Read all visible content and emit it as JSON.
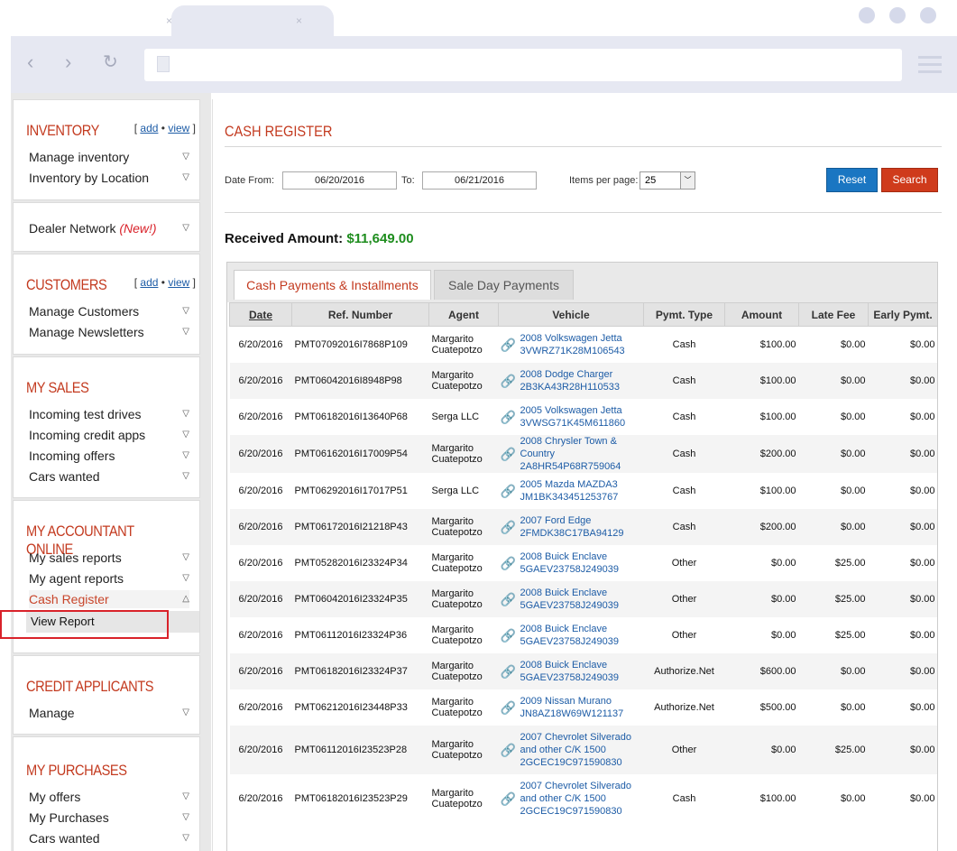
{
  "browser": {
    "tab_close": "×",
    "back": "‹",
    "forward": "›",
    "reload": "↻"
  },
  "sidebar": {
    "inventory": {
      "title": "INVENTORY",
      "add": "add",
      "view": "view",
      "items": [
        "Manage inventory",
        "Inventory by Location"
      ]
    },
    "dealer": {
      "label": "Dealer Network",
      "badge": "(New!)"
    },
    "customers": {
      "title": "CUSTOMERS",
      "add": "add",
      "view": "view",
      "items": [
        "Manage Customers",
        "Manage Newsletters"
      ]
    },
    "sales": {
      "title": "MY SALES",
      "items": [
        "Incoming test drives",
        "Incoming credit apps",
        "Incoming offers",
        "Cars wanted"
      ]
    },
    "accountant": {
      "title": "MY ACCOUNTANT ONLINE",
      "items": [
        "My sales reports",
        "My agent reports",
        "Cash Register"
      ],
      "sub": "View Report"
    },
    "credit": {
      "title": "CREDIT APPLICANTS",
      "items": [
        "Manage"
      ]
    },
    "purchases": {
      "title": "MY PURCHASES",
      "items": [
        "My offers",
        "My Purchases",
        "Cars wanted"
      ]
    }
  },
  "main": {
    "title": "CASH REGISTER",
    "date_from_label": "Date From:",
    "date_from": "06/20/2016",
    "to_label": "To:",
    "date_to": "06/21/2016",
    "items_label": "Items per page:",
    "items_value": "25",
    "reset": "Reset",
    "search": "Search",
    "received_label": "Received Amount:",
    "received_amount": "$11,649.00",
    "tabs": [
      "Cash Payments & Installments",
      "Sale Day Payments"
    ],
    "columns": [
      "Date",
      "Ref. Number",
      "Agent",
      "Vehicle",
      "Pymt. Type",
      "Amount",
      "Late Fee",
      "Early Pymt."
    ],
    "rows": [
      {
        "date": "6/20/2016",
        "ref": "PMT07092016I7868P109",
        "agent": "Margarito Cuatepotzo",
        "vehicle": "2008 Volkswagen Jetta",
        "vin": "3VWRZ71K28M106543",
        "type": "Cash",
        "amount": "$100.00",
        "late": "$0.00",
        "early": "$0.00"
      },
      {
        "date": "6/20/2016",
        "ref": "PMT06042016I8948P98",
        "agent": "Margarito Cuatepotzo",
        "vehicle": "2008 Dodge Charger",
        "vin": "2B3KA43R28H110533",
        "type": "Cash",
        "amount": "$100.00",
        "late": "$0.00",
        "early": "$0.00"
      },
      {
        "date": "6/20/2016",
        "ref": "PMT06182016I13640P68",
        "agent": "Serga LLC",
        "vehicle": "2005 Volkswagen Jetta",
        "vin": "3VWSG71K45M611860",
        "type": "Cash",
        "amount": "$100.00",
        "late": "$0.00",
        "early": "$0.00"
      },
      {
        "date": "6/20/2016",
        "ref": "PMT06162016I17009P54",
        "agent": "Margarito Cuatepotzo",
        "vehicle": "2008 Chrysler Town & Country",
        "vin": "2A8HR54P68R759064",
        "type": "Cash",
        "amount": "$200.00",
        "late": "$0.00",
        "early": "$0.00"
      },
      {
        "date": "6/20/2016",
        "ref": "PMT06292016I17017P51",
        "agent": "Serga LLC",
        "vehicle": "2005 Mazda MAZDA3",
        "vin": "JM1BK343451253767",
        "type": "Cash",
        "amount": "$100.00",
        "late": "$0.00",
        "early": "$0.00"
      },
      {
        "date": "6/20/2016",
        "ref": "PMT06172016I21218P43",
        "agent": "Margarito Cuatepotzo",
        "vehicle": "2007 Ford Edge",
        "vin": "2FMDK38C17BA94129",
        "type": "Cash",
        "amount": "$200.00",
        "late": "$0.00",
        "early": "$0.00"
      },
      {
        "date": "6/20/2016",
        "ref": "PMT05282016I23324P34",
        "agent": "Margarito Cuatepotzo",
        "vehicle": "2008 Buick Enclave",
        "vin": "5GAEV23758J249039",
        "type": "Other",
        "amount": "$0.00",
        "late": "$25.00",
        "early": "$0.00"
      },
      {
        "date": "6/20/2016",
        "ref": "PMT06042016I23324P35",
        "agent": "Margarito Cuatepotzo",
        "vehicle": "2008 Buick Enclave",
        "vin": "5GAEV23758J249039",
        "type": "Other",
        "amount": "$0.00",
        "late": "$25.00",
        "early": "$0.00"
      },
      {
        "date": "6/20/2016",
        "ref": "PMT06112016I23324P36",
        "agent": "Margarito Cuatepotzo",
        "vehicle": "2008 Buick Enclave",
        "vin": "5GAEV23758J249039",
        "type": "Other",
        "amount": "$0.00",
        "late": "$25.00",
        "early": "$0.00"
      },
      {
        "date": "6/20/2016",
        "ref": "PMT06182016I23324P37",
        "agent": "Margarito Cuatepotzo",
        "vehicle": "2008 Buick Enclave",
        "vin": "5GAEV23758J249039",
        "type": "Authorize.Net",
        "amount": "$600.00",
        "late": "$0.00",
        "early": "$0.00"
      },
      {
        "date": "6/20/2016",
        "ref": "PMT06212016I23448P33",
        "agent": "Margarito Cuatepotzo",
        "vehicle": "2009 Nissan Murano",
        "vin": "JN8AZ18W69W121137",
        "type": "Authorize.Net",
        "amount": "$500.00",
        "late": "$0.00",
        "early": "$0.00"
      },
      {
        "date": "6/20/2016",
        "ref": "PMT06112016I23523P28",
        "agent": "Margarito Cuatepotzo",
        "vehicle": "2007 Chevrolet Silverado and other C/K 1500",
        "vin": "2GCEC19C971590830",
        "type": "Other",
        "amount": "$0.00",
        "late": "$25.00",
        "early": "$0.00"
      },
      {
        "date": "6/20/2016",
        "ref": "PMT06182016I23523P29",
        "agent": "Margarito Cuatepotzo",
        "vehicle": "2007 Chevrolet Silverado and other C/K 1500",
        "vin": "2GCEC19C971590830",
        "type": "Cash",
        "amount": "$100.00",
        "late": "$0.00",
        "early": "$0.00"
      }
    ]
  },
  "icons": {
    "caret_down": "▽",
    "caret_up": "△",
    "link": "🔗",
    "select_arrow": "﹀"
  }
}
